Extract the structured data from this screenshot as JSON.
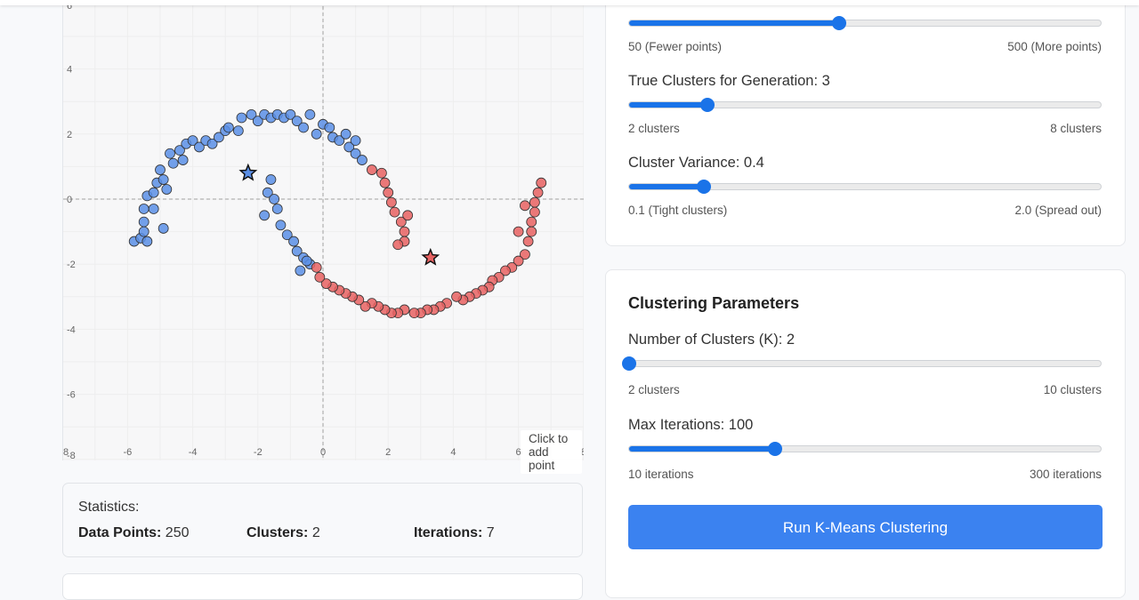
{
  "plot": {
    "hint": "Click to add point",
    "y_tick_labels": [
      "4",
      "2",
      "0",
      "-2",
      "-4",
      "-6",
      "-8",
      "6"
    ],
    "x_tick_labels": [
      "-6",
      "-4",
      "-2",
      "0",
      "2",
      "4",
      "6",
      "8",
      "8"
    ],
    "colors": {
      "cluster_a": "#5b8fe6",
      "cluster_b": "#e86262",
      "grid": "#eeeeee",
      "axis": "#bdbdbd",
      "point_stroke": "#333333"
    }
  },
  "stats": {
    "title": "Statistics:",
    "data_points_label": "Data Points:",
    "data_points_value": "250",
    "clusters_label": "Clusters:",
    "clusters_value": "2",
    "iterations_label": "Iterations:",
    "iterations_value": "7"
  },
  "data_generation": {
    "sliders": [
      {
        "label": "",
        "min_label": "50 (Fewer points)",
        "max_label": "500 (More points)",
        "value": 250,
        "min": 50,
        "max": 500
      },
      {
        "label": "True Clusters for Generation: 3",
        "min_label": "2 clusters",
        "max_label": "8 clusters",
        "value": 3,
        "min": 2,
        "max": 8
      },
      {
        "label": "Cluster Variance: 0.4",
        "min_label": "0.1 (Tight clusters)",
        "max_label": "2.0 (Spread out)",
        "value": 0.4,
        "min": 0.1,
        "max": 2.0
      }
    ]
  },
  "clustering": {
    "title": "Clustering Parameters",
    "sliders": [
      {
        "label": "Number of Clusters (K): 2",
        "min_label": "2 clusters",
        "max_label": "10 clusters",
        "value": 2,
        "min": 2,
        "max": 10
      },
      {
        "label": "Max Iterations: 100",
        "min_label": "10 iterations",
        "max_label": "300 iterations",
        "value": 100,
        "min": 10,
        "max": 300
      }
    ],
    "run_button": "Run K-Means Clustering"
  },
  "chart_data": {
    "type": "scatter",
    "xlim": [
      -8,
      8
    ],
    "ylim": [
      -8,
      6
    ],
    "grid": true,
    "x_ticks": [
      -6,
      -4,
      -2,
      0,
      2,
      4,
      6,
      8
    ],
    "y_ticks": [
      4,
      2,
      0,
      -2,
      -4,
      -6
    ],
    "title": "",
    "xlabel": "",
    "ylabel": "",
    "series": [
      {
        "color": "#5b8fe6",
        "points": [
          [
            -5.8,
            -1.3
          ],
          [
            -5.6,
            -1.2
          ],
          [
            -5.4,
            -1.3
          ],
          [
            -5.5,
            -1.0
          ],
          [
            -5.5,
            -0.7
          ],
          [
            -5.5,
            -0.3
          ],
          [
            -5.4,
            0.1
          ],
          [
            -5.2,
            -0.3
          ],
          [
            -5.2,
            0.2
          ],
          [
            -5.1,
            0.5
          ],
          [
            -5.0,
            0.9
          ],
          [
            -4.9,
            0.6
          ],
          [
            -4.8,
            0.3
          ],
          [
            -4.6,
            1.1
          ],
          [
            -4.4,
            1.5
          ],
          [
            -4.3,
            1.2
          ],
          [
            -4.2,
            1.7
          ],
          [
            -4.0,
            1.8
          ],
          [
            -3.8,
            1.6
          ],
          [
            -3.6,
            1.8
          ],
          [
            -3.4,
            1.7
          ],
          [
            -3.2,
            1.9
          ],
          [
            -3.0,
            2.1
          ],
          [
            -2.9,
            2.2
          ],
          [
            -2.6,
            2.1
          ],
          [
            -2.5,
            2.5
          ],
          [
            -2.2,
            2.6
          ],
          [
            -2.0,
            2.4
          ],
          [
            -1.8,
            2.6
          ],
          [
            -1.6,
            2.5
          ],
          [
            -1.4,
            2.6
          ],
          [
            -1.2,
            2.5
          ],
          [
            -1.0,
            2.6
          ],
          [
            -0.8,
            2.4
          ],
          [
            -0.6,
            2.2
          ],
          [
            -0.4,
            2.6
          ],
          [
            -0.2,
            2.0
          ],
          [
            0.0,
            2.3
          ],
          [
            0.2,
            2.2
          ],
          [
            0.3,
            1.9
          ],
          [
            0.5,
            1.8
          ],
          [
            0.7,
            2.0
          ],
          [
            0.8,
            1.6
          ],
          [
            1.0,
            1.4
          ],
          [
            1.0,
            1.8
          ],
          [
            1.2,
            1.2
          ],
          [
            -1.6,
            0.6
          ],
          [
            -1.7,
            0.2
          ],
          [
            -1.5,
            0.0
          ],
          [
            -1.4,
            -0.3
          ],
          [
            -1.8,
            -0.5
          ],
          [
            -1.3,
            -0.8
          ],
          [
            -1.1,
            -1.1
          ],
          [
            -0.9,
            -1.3
          ],
          [
            -0.8,
            -1.6
          ],
          [
            -0.6,
            -1.8
          ],
          [
            -0.4,
            -2.0
          ],
          [
            -0.7,
            -2.2
          ],
          [
            -0.5,
            -1.9
          ],
          [
            -4.9,
            -0.9
          ],
          [
            -4.7,
            1.4
          ]
        ]
      },
      {
        "color": "#e86262",
        "points": [
          [
            6.7,
            0.5
          ],
          [
            6.6,
            0.2
          ],
          [
            6.5,
            -0.1
          ],
          [
            6.5,
            -0.4
          ],
          [
            6.4,
            -0.7
          ],
          [
            6.4,
            -1.0
          ],
          [
            6.3,
            -1.3
          ],
          [
            6.2,
            -1.7
          ],
          [
            6.0,
            -1.9
          ],
          [
            5.8,
            -2.1
          ],
          [
            5.6,
            -2.2
          ],
          [
            5.4,
            -2.4
          ],
          [
            5.2,
            -2.5
          ],
          [
            5.1,
            -2.7
          ],
          [
            4.9,
            -2.8
          ],
          [
            4.7,
            -2.9
          ],
          [
            4.5,
            -3.0
          ],
          [
            4.3,
            -3.1
          ],
          [
            4.1,
            -3.0
          ],
          [
            3.8,
            -3.2
          ],
          [
            3.6,
            -3.3
          ],
          [
            3.4,
            -3.4
          ],
          [
            3.2,
            -3.4
          ],
          [
            3.0,
            -3.5
          ],
          [
            2.8,
            -3.5
          ],
          [
            2.5,
            -3.4
          ],
          [
            2.3,
            -3.5
          ],
          [
            2.1,
            -3.5
          ],
          [
            1.9,
            -3.4
          ],
          [
            1.7,
            -3.3
          ],
          [
            1.5,
            -3.2
          ],
          [
            1.3,
            -3.3
          ],
          [
            1.1,
            -3.1
          ],
          [
            0.9,
            -3.0
          ],
          [
            0.7,
            -2.9
          ],
          [
            0.5,
            -2.8
          ],
          [
            0.3,
            -2.7
          ],
          [
            0.1,
            -2.6
          ],
          [
            -0.1,
            -2.4
          ],
          [
            -0.2,
            -2.1
          ],
          [
            1.5,
            0.9
          ],
          [
            1.8,
            0.8
          ],
          [
            1.9,
            0.5
          ],
          [
            2.0,
            0.2
          ],
          [
            2.1,
            -0.1
          ],
          [
            2.2,
            -0.4
          ],
          [
            2.4,
            -0.7
          ],
          [
            2.5,
            -1.0
          ],
          [
            2.5,
            -1.3
          ],
          [
            2.3,
            -1.4
          ],
          [
            2.6,
            -0.5
          ],
          [
            6.0,
            -1.0
          ],
          [
            6.2,
            -0.2
          ]
        ]
      }
    ],
    "centroids": [
      {
        "x": -2.3,
        "y": 0.8,
        "color": "#5b8fe6"
      },
      {
        "x": 3.3,
        "y": -1.8,
        "color": "#e86262"
      }
    ]
  }
}
